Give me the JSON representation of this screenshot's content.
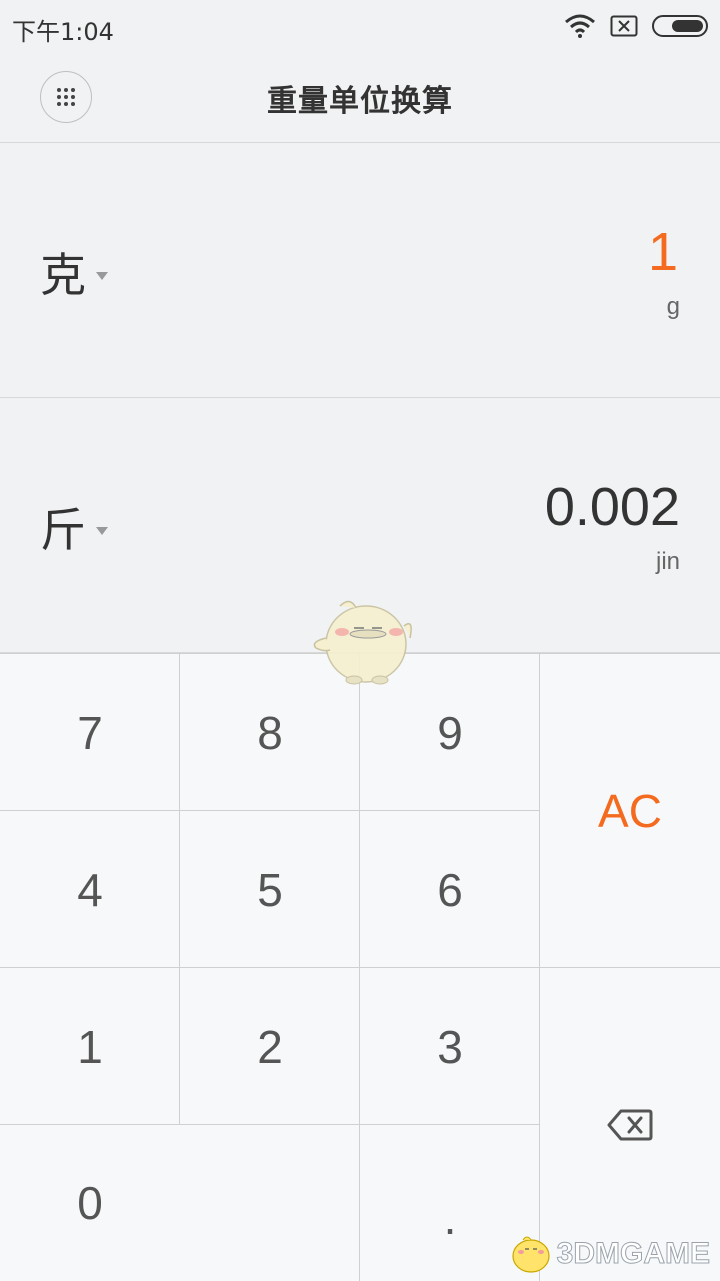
{
  "status_bar": {
    "time": "下午1:04"
  },
  "header": {
    "title": "重量单位换算"
  },
  "converter": {
    "from": {
      "unit": "克",
      "value": "1",
      "symbol": "g"
    },
    "to": {
      "unit": "斤",
      "value": "0.002",
      "symbol": "jin"
    }
  },
  "keypad": {
    "k7": "7",
    "k8": "8",
    "k9": "9",
    "k4": "4",
    "k5": "5",
    "k6": "6",
    "k1": "1",
    "k2": "2",
    "k3": "3",
    "k0": "0",
    "dot": ".",
    "ac": "AC"
  },
  "watermark": {
    "text": "3DMGAME"
  },
  "colors": {
    "accent": "#f46a1e",
    "text": "#333333",
    "background": "#f1f2f3",
    "keypad_bg": "#f7f8f9"
  },
  "icons": [
    "wifi-icon",
    "no-sim-icon",
    "battery-icon",
    "grid-menu-icon",
    "dropdown-caret-icon",
    "backspace-icon"
  ]
}
